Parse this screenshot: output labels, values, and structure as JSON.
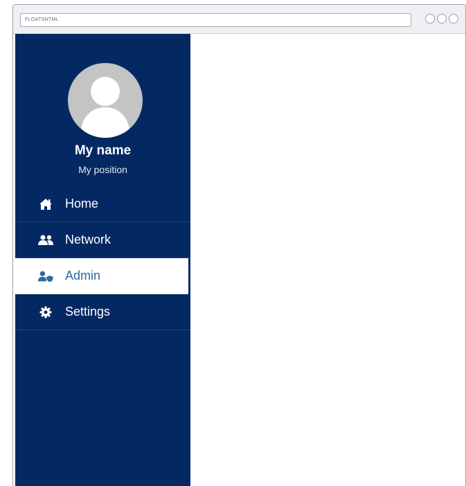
{
  "browser": {
    "address_text": "FLOATSHTML"
  },
  "profile": {
    "name": "My name",
    "position": "My position"
  },
  "nav": {
    "items": [
      {
        "label": "Home",
        "icon": "home-icon",
        "active": false
      },
      {
        "label": "Network",
        "icon": "users-icon",
        "active": false
      },
      {
        "label": "Admin",
        "icon": "user-shield-icon",
        "active": true
      },
      {
        "label": "Settings",
        "icon": "gear-icon",
        "active": false
      }
    ]
  },
  "colors": {
    "sidebar": "#042862",
    "active_text": "#2c6aa0",
    "divider": "#1d4a84"
  }
}
